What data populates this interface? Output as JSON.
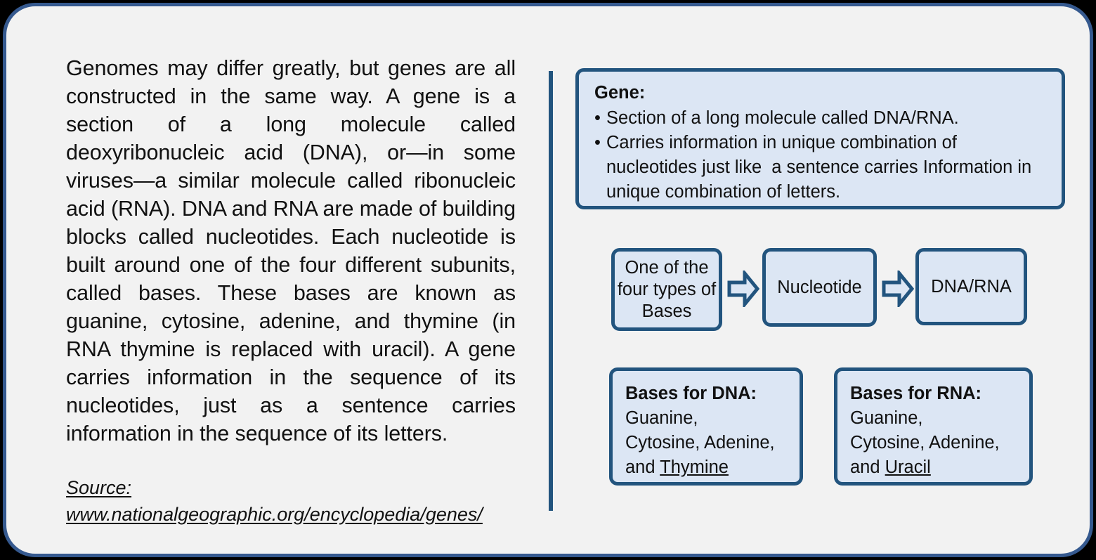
{
  "colors": {
    "page_background": "#000000",
    "card_background": "#f2f2f2",
    "card_border": "#35598f",
    "accent_navy": "#22547e",
    "box_fill": "#dce6f4",
    "text": "#111111"
  },
  "left_panel": {
    "paragraph": "Genomes may differ greatly, but genes are all constructed in the same way. A gene is a section of a long molecule called deoxyribonucleic acid (DNA), or—in some viruses—a similar molecule called ribonucleic acid (RNA). DNA and RNA are made of building blocks called nucleotides. Each nucleotide is built around one of the four different subunits, called bases. These bases are known as guanine, cytosine, adenine, and thymine (in RNA thymine is replaced with uracil). A gene carries information in the sequence of its nucleotides, just as a sentence carries information in the sequence of its letters.",
    "source_label": "Source:",
    "source_url": "www.nationalgeographic.org/encyclopedia/genes/"
  },
  "right_panel": {
    "gene_box": {
      "title": "Gene:",
      "bullets": [
        "Section of a long molecule called DNA/RNA.",
        "Carries information in unique combination of nucleotides just like  a sentence carries Information in unique combination of letters."
      ]
    },
    "flow": {
      "steps": [
        {
          "label": "One of the four types of Bases"
        },
        {
          "label": "Nucleotide"
        },
        {
          "label": "DNA/RNA"
        }
      ],
      "arrow_icon": "right-block-arrow-icon"
    },
    "base_boxes": [
      {
        "title": "Bases for DNA:",
        "line1": "Guanine,",
        "line2": "Cytosine, Adenine,",
        "line3_prefix": "and ",
        "line3_underlined": "Thymine"
      },
      {
        "title": "Bases for RNA:",
        "line1": "Guanine,",
        "line2": "Cytosine, Adenine,",
        "line3_prefix": "and ",
        "line3_underlined": "Uracil"
      }
    ]
  }
}
